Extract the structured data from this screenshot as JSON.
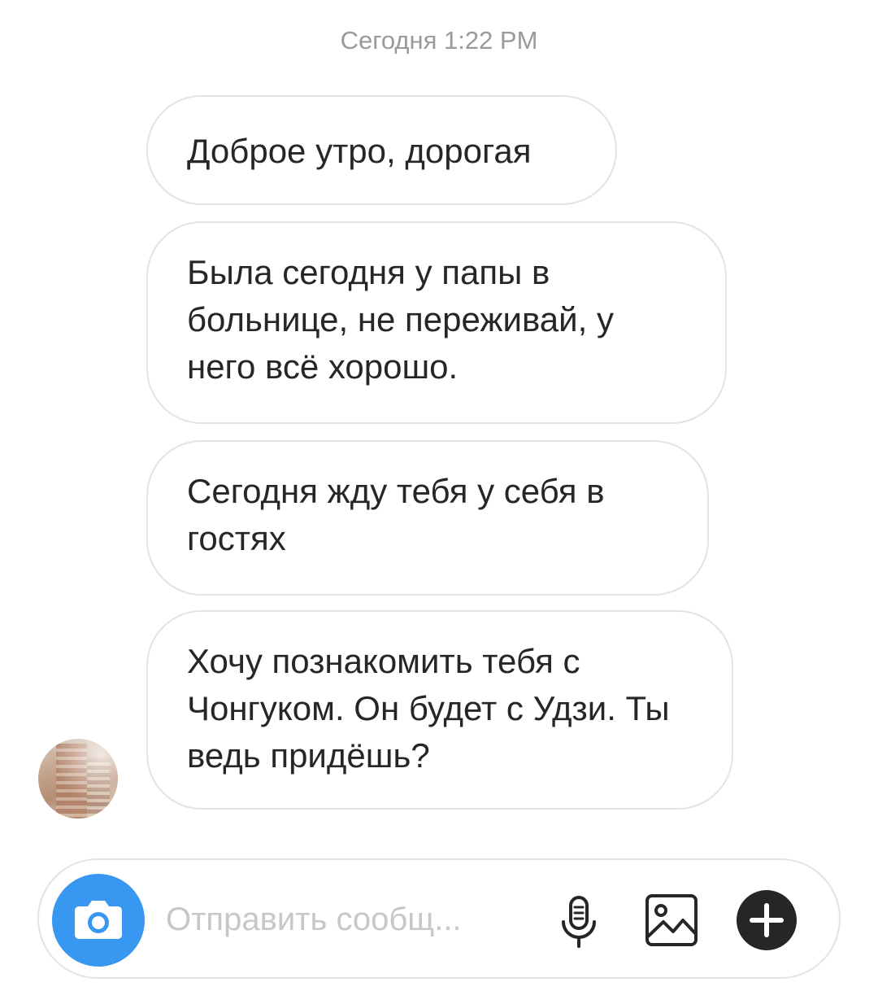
{
  "chat": {
    "timestamp": "Сегодня 1:22 PM",
    "messages": [
      {
        "text": "Доброе утро, дорогая"
      },
      {
        "text": "Была сегодня у папы в больнице, не переживай, у него всё хорошо."
      },
      {
        "text": "Сегодня жду тебя у себя в гостях"
      },
      {
        "text": "Хочу познакомить тебя с Чонгуком. Он будет с Удзи. Ты ведь придёшь?"
      }
    ]
  },
  "composer": {
    "placeholder": "Отправить сообщ...",
    "value": "",
    "icons": [
      "camera-icon",
      "microphone-icon",
      "image-icon",
      "plus-icon"
    ]
  },
  "colors": {
    "accent": "#3897f0",
    "bubble_border": "#e3e3e3",
    "text": "#262626",
    "muted": "#9a9a9a"
  }
}
